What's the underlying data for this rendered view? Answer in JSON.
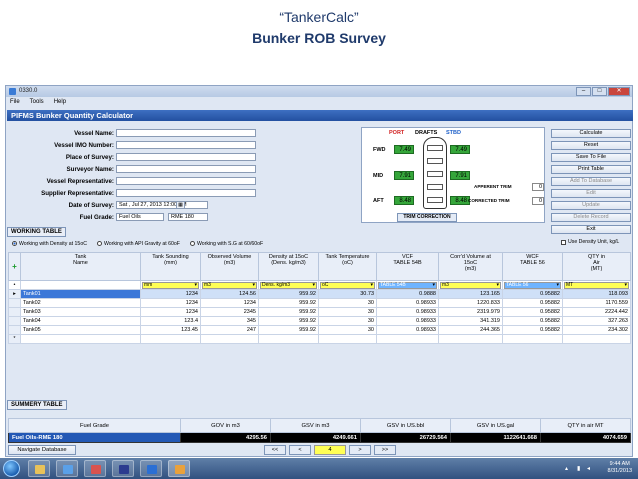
{
  "slide": {
    "title": "“TankerCalc”",
    "subtitle": "Bunker ROB Survey"
  },
  "window": {
    "title": "0330.0",
    "buttons": {
      "minimize": "–",
      "maximize": "□",
      "close": "✕"
    }
  },
  "menu": [
    "File",
    "Tools",
    "Help"
  ],
  "app_title": "PIFMS Bunker Quantity Calculator",
  "form": {
    "fields": [
      {
        "label": "Vessel Name:",
        "value": ""
      },
      {
        "label": "Vessel IMO Number:",
        "value": ""
      },
      {
        "label": "Place of Survey:",
        "value": ""
      },
      {
        "label": "Surveyor Name:",
        "value": ""
      },
      {
        "label": "Vessel Representative:",
        "value": ""
      },
      {
        "label": "Supplier Representative:",
        "value": ""
      }
    ],
    "date_label": "Date of Survey:",
    "date_value": "Sat , Jul  27, 2013 12:00 AM",
    "fuel_label": "Fuel Grade:",
    "fuel_type": "Fuel Oils",
    "fuel_grade": "RME 180"
  },
  "drafts": {
    "port_label": "PORT",
    "drafts_label": "DRAFTS",
    "stbd_label": "STBD",
    "rows": [
      {
        "label": "FWD",
        "port": "7.49",
        "stbd": "7.49"
      },
      {
        "label": "MID",
        "port": "7.91",
        "stbd": "7.91"
      },
      {
        "label": "AFT",
        "port": "8.48",
        "stbd": "8.48"
      }
    ],
    "apparent_trim_label": "APPERENT TRIM",
    "apparent_trim": "0",
    "corrected_trim_label": "CORRECTED TRIM",
    "corrected_trim": "0",
    "trim_button": "TRIM CORRECTION"
  },
  "side_buttons": [
    {
      "label": "Calculate",
      "enabled": true
    },
    {
      "label": "Reset",
      "enabled": true
    },
    {
      "label": "Save To File",
      "enabled": true
    },
    {
      "label": "Print Table",
      "enabled": true
    },
    {
      "label": "Add To Database",
      "enabled": false
    },
    {
      "label": "Edit",
      "enabled": false
    },
    {
      "label": "Update",
      "enabled": false
    },
    {
      "label": "Delete Record",
      "enabled": false
    },
    {
      "label": "Exit",
      "enabled": true
    }
  ],
  "working_table": {
    "tab": "WORKING TABLE",
    "radios": [
      {
        "label": "Working with Density at 15oC",
        "selected": true
      },
      {
        "label": "Working with API Gravity at 60oF",
        "selected": false
      },
      {
        "label": "Working with S.G at 60/60oF",
        "selected": false
      }
    ],
    "density_unit_label": "Use Density Unit, kg/L",
    "columns": [
      {
        "line1": "Tank",
        "line2": "Name",
        "line3": ""
      },
      {
        "line1": "Tank Sounding",
        "line2": "(mm)",
        "line3": ""
      },
      {
        "line1": "Observed Volume",
        "line2": "(m3)",
        "line3": ""
      },
      {
        "line1": "Density at 15oC",
        "line2": "(Dens. kg/m3)",
        "line3": ""
      },
      {
        "line1": "Tank Temperature",
        "line2": "(oC)",
        "line3": ""
      },
      {
        "line1": "VCF",
        "line2": "",
        "line3": "TABLE 54B"
      },
      {
        "line1": "Corr'd Volume at",
        "line2": "15oC",
        "line3": "(m3)"
      },
      {
        "line1": "WCF",
        "line2": "",
        "line3": "TABLE 56"
      },
      {
        "line1": "QTY in",
        "line2": "Air",
        "line3": "(MT)"
      }
    ],
    "units": [
      "mm",
      "m3",
      "Dens. kg/m3",
      "oC",
      "TABLE 54B",
      "m3",
      "TABLE 56",
      "MT"
    ],
    "rows": [
      [
        "Tank01",
        "1234",
        "124.56",
        "959.92",
        "30.73",
        "0.9888",
        "123.165",
        "0.95882",
        "118.093"
      ],
      [
        "Tank02",
        "1234",
        "1234",
        "959.92",
        "30",
        "0.98933",
        "1220.833",
        "0.95882",
        "1170.559"
      ],
      [
        "Tank03",
        "1234",
        "2345",
        "959.92",
        "30",
        "0.98933",
        "2319.979",
        "0.95882",
        "2224.442"
      ],
      [
        "Tank04",
        "123.4",
        "345",
        "959.92",
        "30",
        "0.98933",
        "341.319",
        "0.95882",
        "327.263"
      ],
      [
        "Tank05",
        "123.45",
        "247",
        "959.92",
        "30",
        "0.98933",
        "244.365",
        "0.95882",
        "234.302"
      ]
    ],
    "add_icon": "+",
    "new_row_icon": "*"
  },
  "summary_table": {
    "tab": "SUMMERY TABLE",
    "columns": [
      "Fuel Grade",
      "GOV in m3",
      "GSV in m3",
      "GSV in US.bbl",
      "GSV in US.gal",
      "QTY in air MT"
    ],
    "row": [
      "Fuel Oils-RME 180",
      "4295.56",
      "4249.661",
      "26729.564",
      "1122641.668",
      "4074.659"
    ]
  },
  "navigation": {
    "button": "Navigate Database",
    "first": "<<",
    "prev": "<",
    "page": "4",
    "next": ">",
    "last": ">>"
  },
  "taskbar": {
    "time": "9:44 AM",
    "date": "8/31/2013"
  },
  "colors": {
    "app_bar": "#2f5fb3",
    "draft_green": "#35a63a",
    "unit_yellow": "#ffff55",
    "summary_black": "#000000",
    "selected_blue": "#3c78d8"
  }
}
